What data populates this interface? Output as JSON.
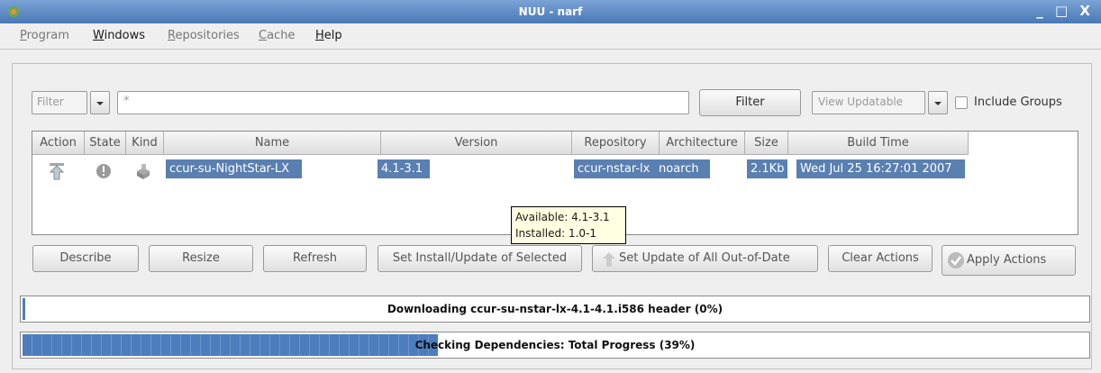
{
  "window": {
    "title": "NUU - narf",
    "minimize": "_",
    "maximize": "□",
    "close": "X"
  },
  "menu": [
    {
      "label": "Program",
      "enabled": false
    },
    {
      "label": "Windows",
      "enabled": true
    },
    {
      "label": "Repositories",
      "enabled": false
    },
    {
      "label": "Cache",
      "enabled": false
    },
    {
      "label": "Help",
      "enabled": true
    }
  ],
  "filter": {
    "field_value": "Filter",
    "pattern": "*",
    "button_label": "Filter",
    "view_value": "View Updatable",
    "include_groups_label": "Include Groups",
    "include_groups_checked": false
  },
  "table": {
    "headers": [
      "Action",
      "State",
      "Kind",
      "Name",
      "Version",
      "Repository",
      "Architecture",
      "Size",
      "Build Time"
    ],
    "rows": [
      {
        "name": "ccur-su-NightStar-LX",
        "version": "4.1-3.1",
        "repository": "ccur-nstar-lx",
        "architecture": "noarch",
        "size": "2.1Kb",
        "build_time": "Wed Jul 25 16:27:01 2007"
      }
    ]
  },
  "tooltip": {
    "available": "Available: 4.1-3.1",
    "installed": "Installed: 1.0-1"
  },
  "actions": {
    "describe": "Describe",
    "resize": "Resize",
    "refresh": "Refresh",
    "set_install": "Set Install/Update of Selected",
    "set_update_all": "Set Update of All Out-of-Date",
    "clear": "Clear Actions",
    "apply": "Apply Actions"
  },
  "progress": {
    "download": {
      "text": "Downloading ccur-su-nstar-lx-4.1-4.1.i586 header (0%)",
      "fraction": 0.0
    },
    "total": {
      "text": "Checking Dependencies: Total Progress (39%)",
      "fraction": 0.39
    }
  },
  "colors": {
    "selection": "#5a7fb1",
    "progress": "#4d7dbd",
    "titlebar": "#4a78b4"
  }
}
